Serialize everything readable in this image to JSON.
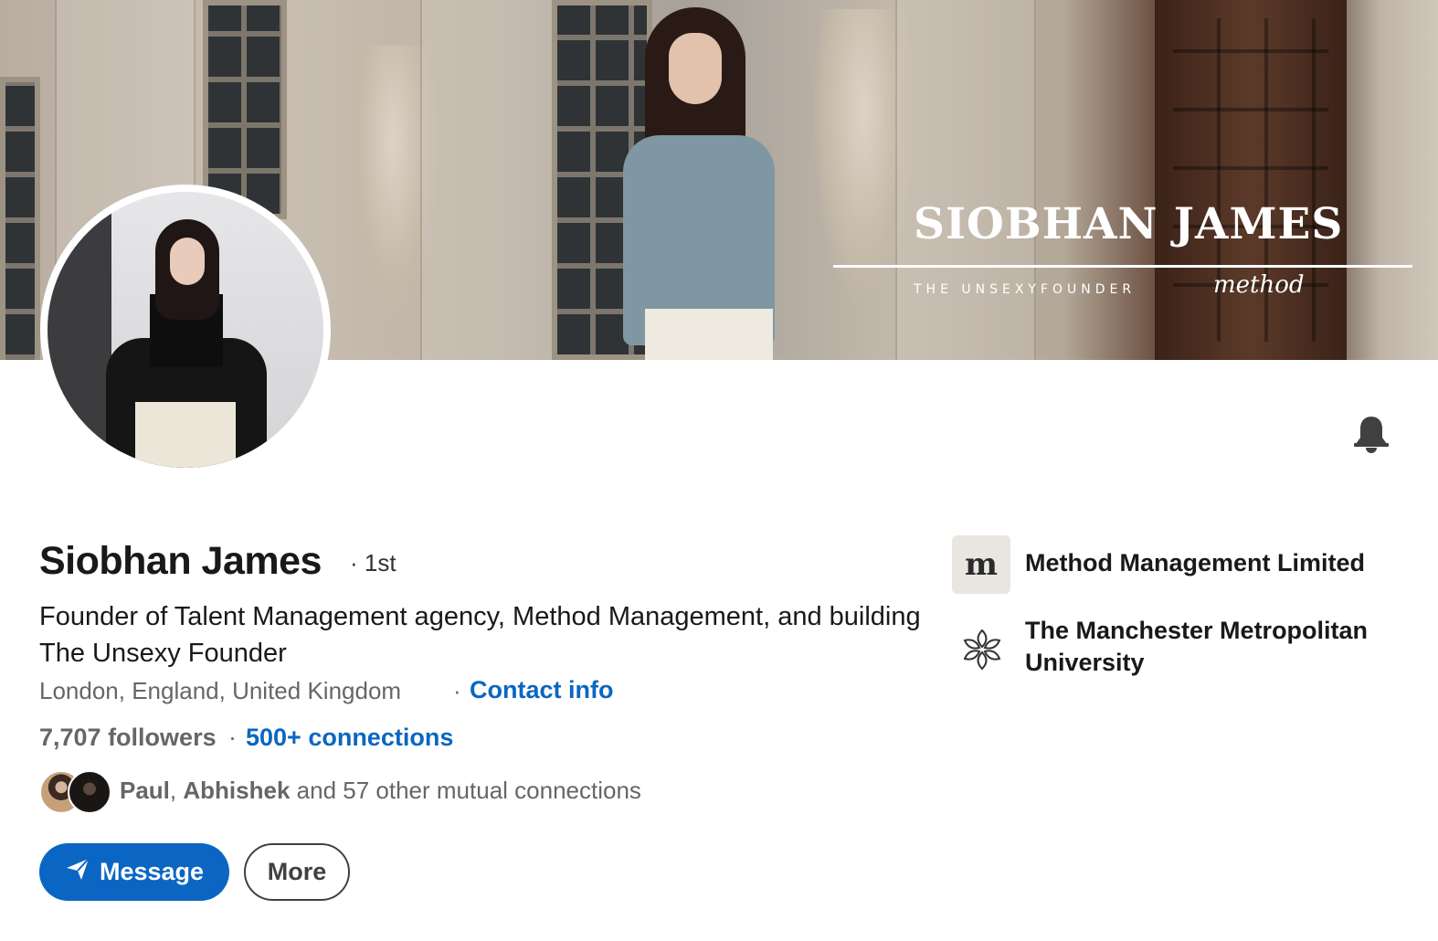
{
  "banner": {
    "title": "SIOBHAN JAMES",
    "subtitle": "THE UNSEXYFOUNDER",
    "brand": "method"
  },
  "profile": {
    "name": "Siobhan James",
    "degree": "· 1st",
    "headline": "Founder of Talent Management agency, Method Management, and building The Unsexy Founder",
    "location": "London, England, United Kingdom",
    "separator": "·",
    "contact_info": "Contact info",
    "followers": "7,707 followers",
    "connections_separator": "·",
    "connections": "500+ connections",
    "mutual": {
      "name1": "Paul",
      "comma": ",",
      "name2": "Abhishek",
      "rest": "and 57 other mutual connections"
    }
  },
  "actions": {
    "message_label": "Message",
    "more_label": "More"
  },
  "experience": [
    {
      "logo_letter": "m",
      "name": "Method Management Limited"
    },
    {
      "name": "The Manchester Metropolitan University"
    }
  ],
  "icons": {
    "bell": "bell-icon",
    "send": "paper-plane-icon",
    "university": "flower-logo-icon"
  },
  "colors": {
    "accent": "#0a66c2",
    "text": "#191919",
    "muted": "#666666"
  }
}
